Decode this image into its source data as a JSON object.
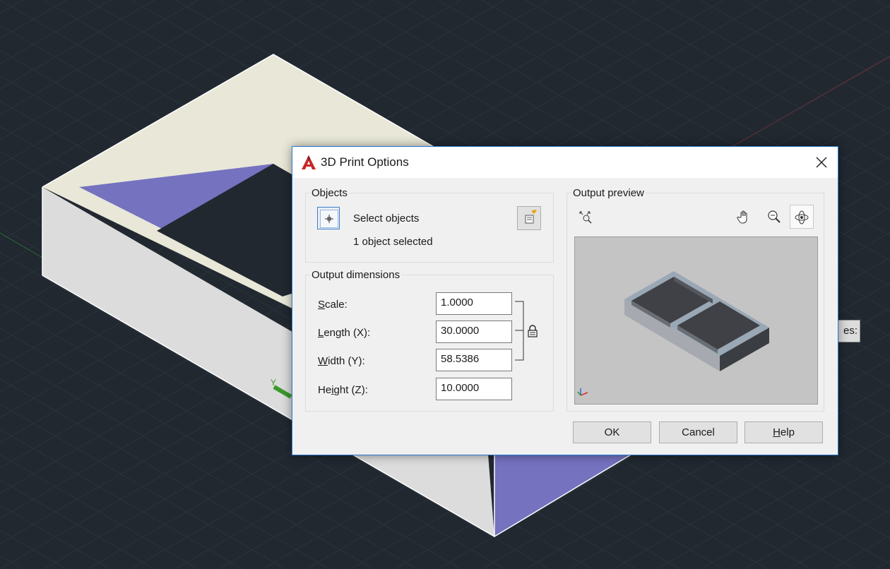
{
  "dialog": {
    "title": "3D Print Options",
    "app_icon": "autocad-logo-icon",
    "close_icon": "close-icon"
  },
  "objects": {
    "group_label": "Objects",
    "select_label": "Select objects",
    "status": "1 object selected",
    "select_icon": "crosshair-pick-icon",
    "quick_select_icon": "quick-select-icon"
  },
  "output_dimensions": {
    "group_label": "Output dimensions",
    "lock_icon": "lock-icon",
    "fields": [
      {
        "label_mnemonic": "S",
        "label_rest": "cale:",
        "value": "1.0000"
      },
      {
        "label_mnemonic": "L",
        "label_rest": "ength (X):",
        "value": "30.0000"
      },
      {
        "label_mnemonic": "W",
        "label_rest": "idth (Y):",
        "value": "58.5386"
      },
      {
        "label_prefix": "He",
        "label_mnemonic": "i",
        "label_rest": "ght (Z):",
        "value": "10.0000"
      }
    ]
  },
  "preview": {
    "group_label": "Output preview",
    "tools": [
      "zoom-extents-icon",
      "pan-icon",
      "zoom-icon",
      "orbit-icon"
    ],
    "active_tool": "orbit-icon"
  },
  "buttons": {
    "ok": "OK",
    "cancel": "Cancel",
    "help": "Help"
  },
  "background": {
    "properties_tab_text": "es:"
  },
  "colors": {
    "canvas_bg": "#212830",
    "dialog_bg": "#f0f0f0",
    "accent_border": "#2b79d0",
    "model_top": "#e9e8d8",
    "model_inner_face": "#7572c0",
    "model_outer_face": "#dcdcdc",
    "logo_red": "#c62828"
  }
}
